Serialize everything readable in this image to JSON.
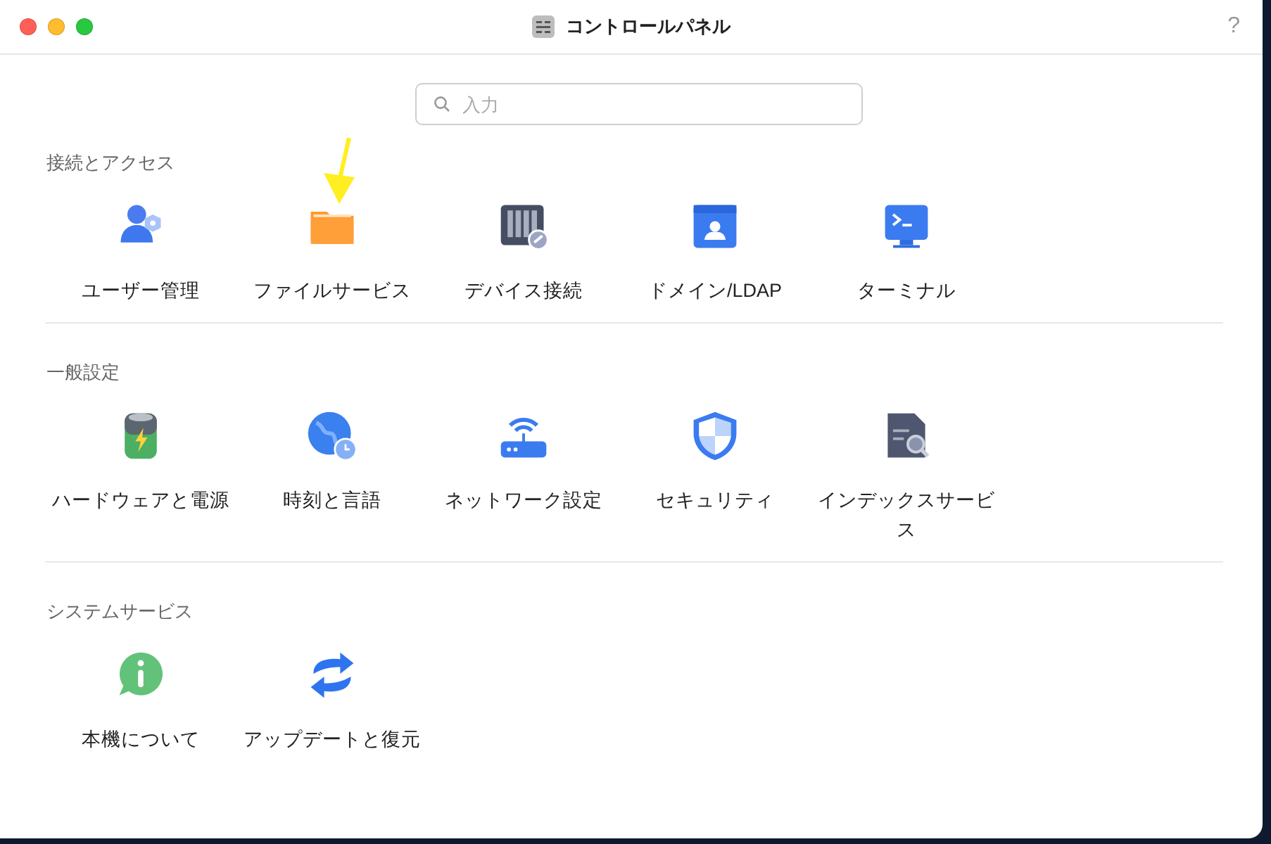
{
  "window": {
    "title": "コントロールパネル",
    "help": "?"
  },
  "search": {
    "placeholder": "入力"
  },
  "sections": [
    {
      "title": "接続とアクセス",
      "items": [
        {
          "label": "ユーザー管理"
        },
        {
          "label": "ファイルサービス"
        },
        {
          "label": "デバイス接続"
        },
        {
          "label": "ドメイン/LDAP"
        },
        {
          "label": "ターミナル"
        }
      ]
    },
    {
      "title": "一般設定",
      "items": [
        {
          "label": "ハードウェアと電源"
        },
        {
          "label": "時刻と言語"
        },
        {
          "label": "ネットワーク設定"
        },
        {
          "label": "セキュリティ"
        },
        {
          "label": "インデックスサービス"
        }
      ]
    },
    {
      "title": "システムサービス",
      "items": [
        {
          "label": "本機について"
        },
        {
          "label": "アップデートと復元"
        }
      ]
    }
  ]
}
